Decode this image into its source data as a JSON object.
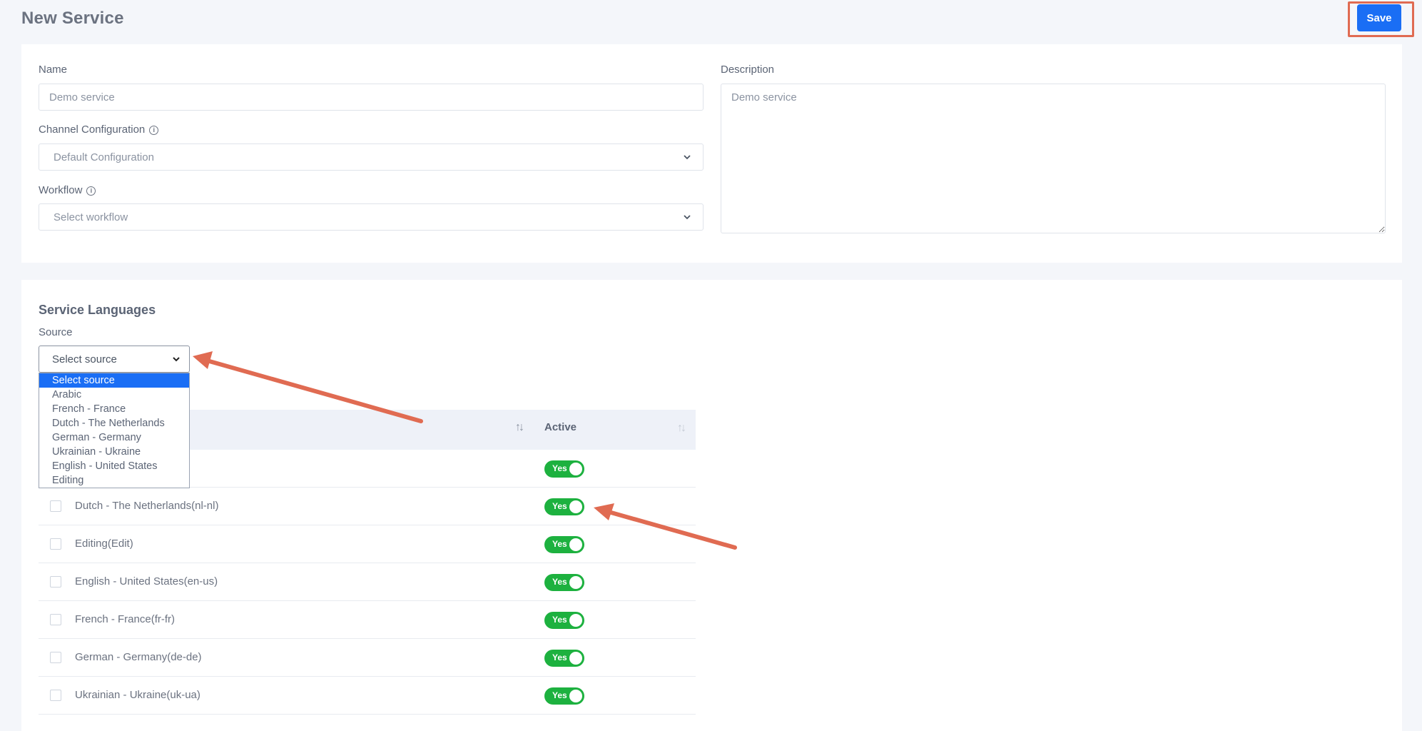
{
  "header": {
    "title": "New Service",
    "save_label": "Save"
  },
  "form": {
    "name_label": "Name",
    "name_value": "Demo service",
    "description_label": "Description",
    "description_value": "Demo service",
    "channel_label": "Channel Configuration",
    "channel_value": "Default Configuration",
    "workflow_label": "Workflow",
    "workflow_value": "Select workflow",
    "info_glyph": "i"
  },
  "languages": {
    "title": "Service Languages",
    "source_label": "Source",
    "source_value": "Select source",
    "options": [
      "Select source",
      "Arabic",
      "French - France",
      "Dutch - The Netherlands",
      "German - Germany",
      "Ukrainian - Ukraine",
      "English - United States",
      "Editing"
    ],
    "table": {
      "active_header": "Active",
      "sort_glyph": "↑↓",
      "rows": [
        {
          "label": "",
          "active": "Yes"
        },
        {
          "label": "Dutch - The Netherlands(nl-nl)",
          "active": "Yes"
        },
        {
          "label": "Editing(Edit)",
          "active": "Yes"
        },
        {
          "label": "English - United States(en-us)",
          "active": "Yes"
        },
        {
          "label": "French - France(fr-fr)",
          "active": "Yes"
        },
        {
          "label": "German - Germany(de-de)",
          "active": "Yes"
        },
        {
          "label": "Ukrainian - Ukraine(uk-ua)",
          "active": "Yes"
        }
      ]
    }
  },
  "colors": {
    "accent": "#1a6ef5",
    "toggle_on": "#1db13f",
    "annotation": "#e06b52"
  },
  "icons": [
    "chevron-down-icon",
    "info-icon",
    "sort-icon",
    "annotation-arrow"
  ]
}
